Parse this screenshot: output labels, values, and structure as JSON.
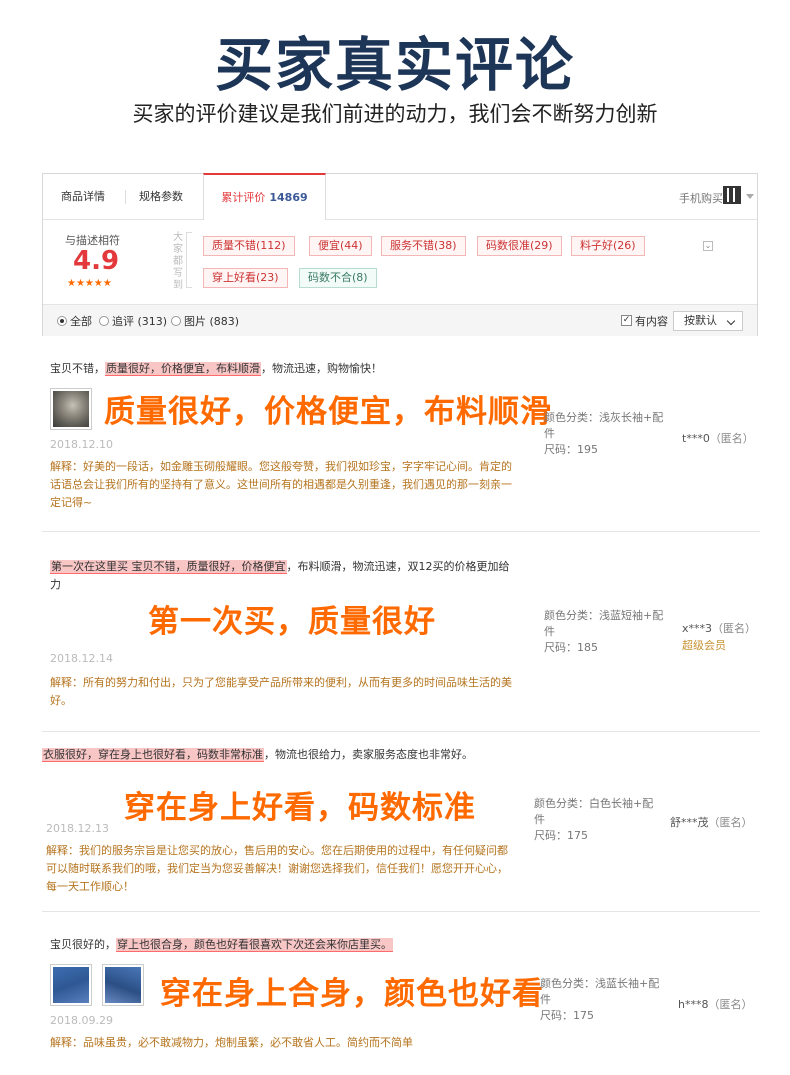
{
  "hero": {
    "title": "买家真实评论",
    "subtitle": "买家的评价建议是我们前进的动力，我们会不断努力创新"
  },
  "tabs": {
    "details": "商品详情",
    "specs": "规格参数",
    "reviews": "累计评价",
    "reviews_count": "14869",
    "mobile_buy": "手机购买"
  },
  "summary": {
    "label": "与描述相符",
    "score": "4.9",
    "stars": "★★★★★",
    "everyone_says": "大家都写到",
    "tags": [
      "质量不错(112)",
      "便宜(44)",
      "服务不错(38)",
      "码数很准(29)",
      "料子好(26)",
      "穿上好看(23)",
      "码数不合(8)"
    ]
  },
  "filters": {
    "all": "全部",
    "followup": "追评 (313)",
    "pictures": "图片 (883)",
    "has_content": "有内容",
    "sort": "按默认"
  },
  "reviews": [
    {
      "text_before": "宝贝不错，",
      "highlight": "质量很好，价格便宜，布料顺滑",
      "text_after": "，物流迅速，购物愉快！",
      "callout": "质量很好，价格便宜，布料顺滑",
      "date": "2018.12.10",
      "reply": "解释：好美的一段话，如金雕玉砌般耀眼。您这般夸赞，我们视如珍宝，字字牢记心间。肯定的话语总会让我们所有的坚持有了意义。这世间所有的相遇都是久别重逢，我们遇见的那一刻亲一定记得~",
      "color": "颜色分类：浅灰长袖+配件",
      "size": "尺码：195",
      "user": "t***0",
      "anon": "（匿名）"
    },
    {
      "highlight": "第一次在这里买 宝贝不错，质量很好，价格便宜",
      "text_after": "，布料顺滑，物流迅速，双12买的价格更加给力",
      "callout": "第一次买，质量很好",
      "date": "2018.12.14",
      "reply": "解释：所有的努力和付出，只为了您能享受产品所带来的便利，从而有更多的时间品味生活的美好。",
      "color": "颜色分类：浅蓝短袖+配件",
      "size": "尺码：185",
      "user": "x***3",
      "anon": "（匿名）",
      "member": "超级会员"
    },
    {
      "highlight": "衣服很好，穿在身上也很好看，码数非常标准",
      "text_after": "，物流也很给力，卖家服务态度也非常好。",
      "callout": "穿在身上好看，码数标准",
      "date": "2018.12.13",
      "reply": "解释：我们的服务宗旨是让您买的放心，售后用的安心。您在后期使用的过程中，有任何疑问都可以随时联系我们的哦，我们定当为您妥善解决！谢谢您选择我们，信任我们！愿您开开心心，每一天工作顺心！",
      "color": "颜色分类：白色长袖+配件",
      "size": "尺码：175",
      "user": "舒***茂",
      "anon": "（匿名）"
    },
    {
      "text_before": "宝贝很好的，",
      "highlight": "穿上也很合身，颜色也好看很喜欢下次还会来你店里买。",
      "callout": "穿在身上合身，颜色也好看",
      "date": "2018.09.29",
      "reply": "解释：品味虽贵，必不敢减物力，炮制虽繁，必不敢省人工。简约而不简单",
      "color": "颜色分类：浅蓝长袖+配件",
      "size": "尺码：175",
      "user": "h***8",
      "anon": "（匿名）"
    }
  ],
  "colors": {
    "accent": "#e4393c",
    "callout": "#ff6a00",
    "reply": "#b5741e",
    "hero": "#1d3557"
  }
}
